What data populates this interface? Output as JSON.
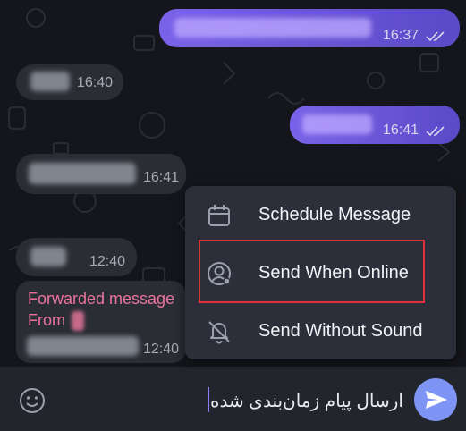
{
  "messages": [
    {
      "dir": "out",
      "time": "16:37"
    },
    {
      "dir": "in",
      "time": "16:40"
    },
    {
      "dir": "out",
      "time": "16:41"
    },
    {
      "dir": "in",
      "time": "16:41"
    },
    {
      "dir": "in",
      "time": "12:40"
    },
    {
      "dir": "in",
      "time": "12:40",
      "forward_title": "Forwarded message",
      "forward_from": "From"
    }
  ],
  "menu": {
    "items": [
      {
        "label": "Schedule Message",
        "icon": "calendar-icon"
      },
      {
        "label": "Send When Online",
        "icon": "user-online-icon",
        "highlighted": true
      },
      {
        "label": "Send Without Sound",
        "icon": "bell-off-icon"
      }
    ]
  },
  "composer": {
    "text": "ارسال پیام زمان‌بندی شده",
    "emoji_icon": "emoji-icon",
    "send_icon": "send-icon"
  },
  "colors": {
    "accent": "#7f95f5",
    "outgoing": "#6b55d8",
    "highlight_border": "#e0303a",
    "forward_text": "#e8749a"
  }
}
